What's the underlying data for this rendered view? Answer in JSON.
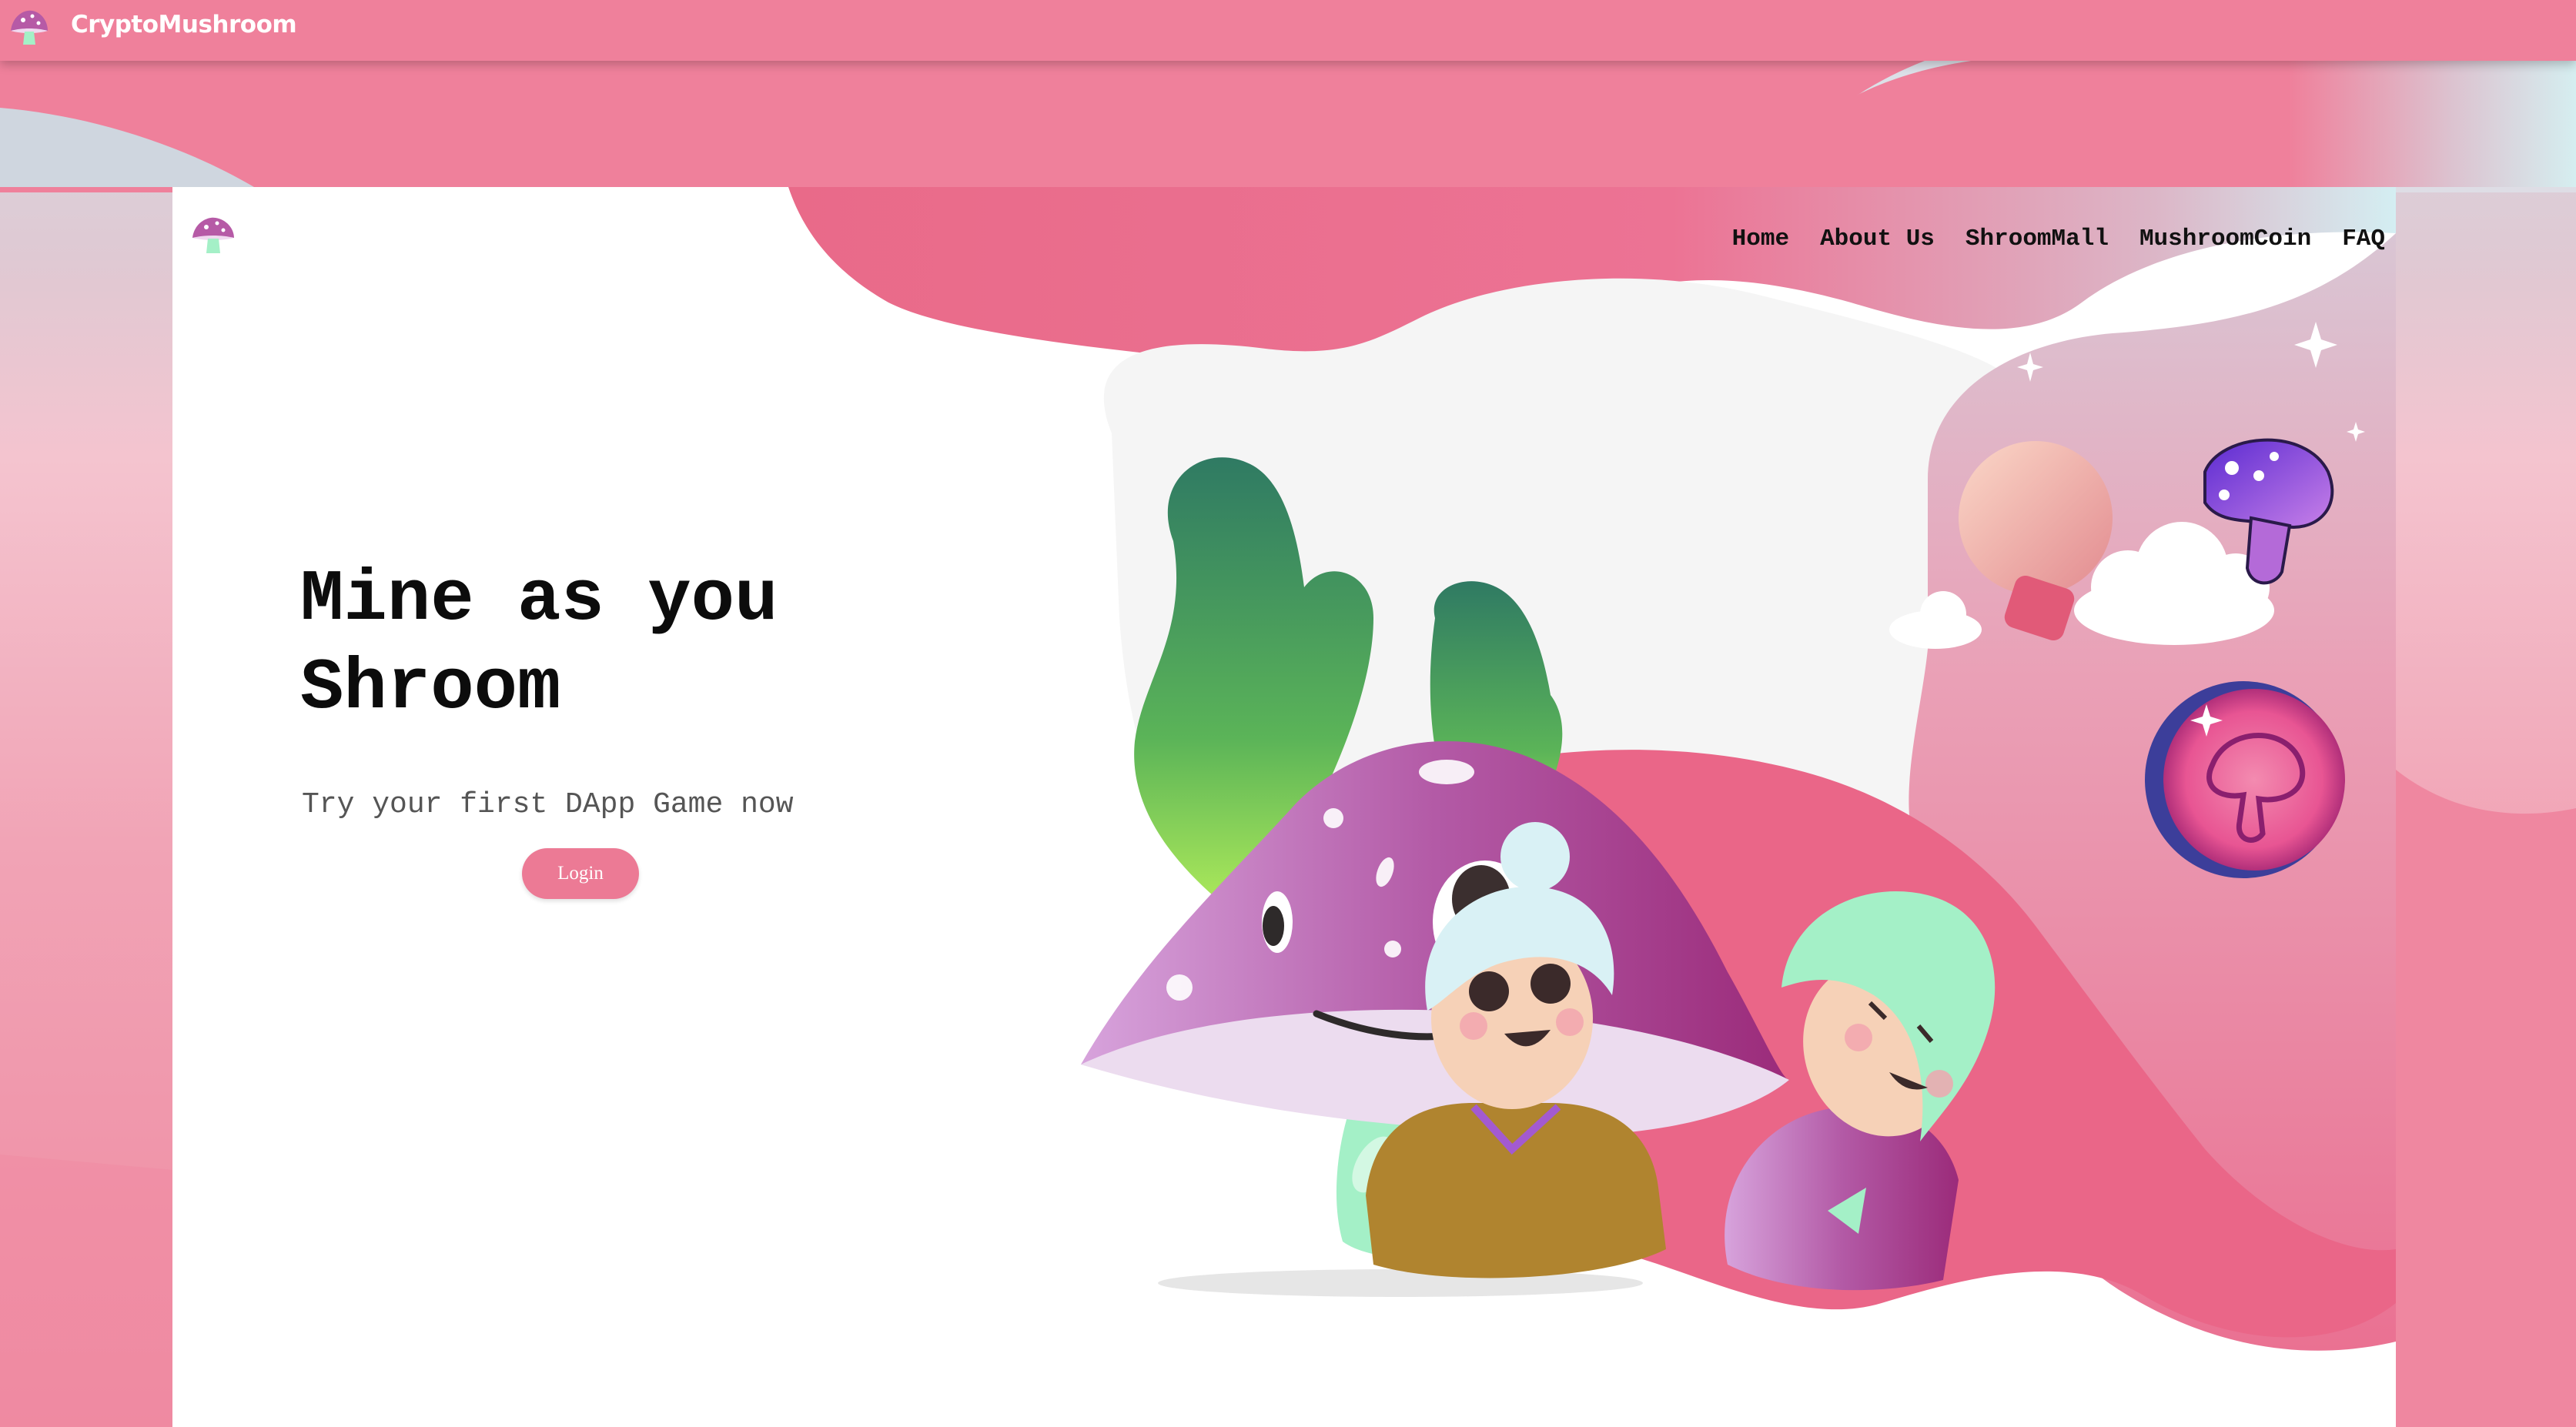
{
  "app": {
    "brand": "CryptoMushroom"
  },
  "nav": {
    "items": [
      "Home",
      "About Us",
      "ShroomMall",
      "MushroomCoin",
      "FAQ"
    ]
  },
  "hero": {
    "title": "Mine as you Shroom",
    "subtitle": "Try your first DApp Game now",
    "login_label": "Login"
  },
  "icons": {
    "brand_logo": "mushroom-logo-icon",
    "page_logo": "mushroom-logo-icon",
    "illustration": "mushroom-hero-illustration"
  },
  "colors": {
    "topbar": "#ef809b",
    "accent": "#ec7a95",
    "pink_blob": "#ec6b8a",
    "mushroom_purple": "#a24f9c",
    "mint": "#a4f0c7",
    "leaf_green": "#3a8a63"
  }
}
